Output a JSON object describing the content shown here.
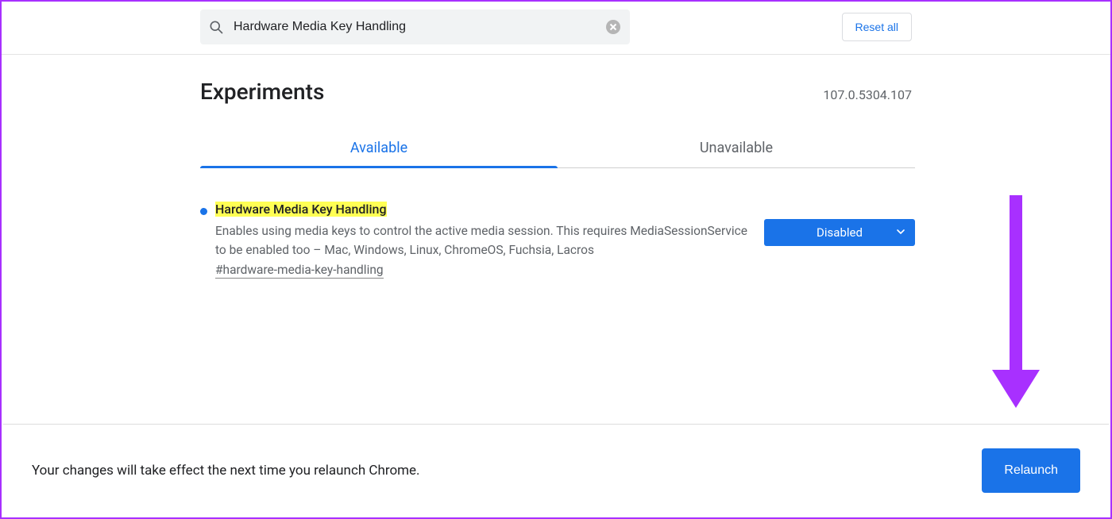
{
  "search": {
    "value": "Hardware Media Key Handling"
  },
  "header": {
    "reset_label": "Reset all",
    "title": "Experiments",
    "version": "107.0.5304.107"
  },
  "tabs": {
    "available": "Available",
    "unavailable": "Unavailable"
  },
  "flag": {
    "title": "Hardware Media Key Handling",
    "description": "Enables using media keys to control the active media session. This requires MediaSessionService to be enabled too – Mac, Windows, Linux, ChromeOS, Fuchsia, Lacros",
    "hash": "#hardware-media-key-handling",
    "state": "Disabled"
  },
  "footer": {
    "message": "Your changes will take effect the next time you relaunch Chrome.",
    "relaunch_label": "Relaunch"
  }
}
